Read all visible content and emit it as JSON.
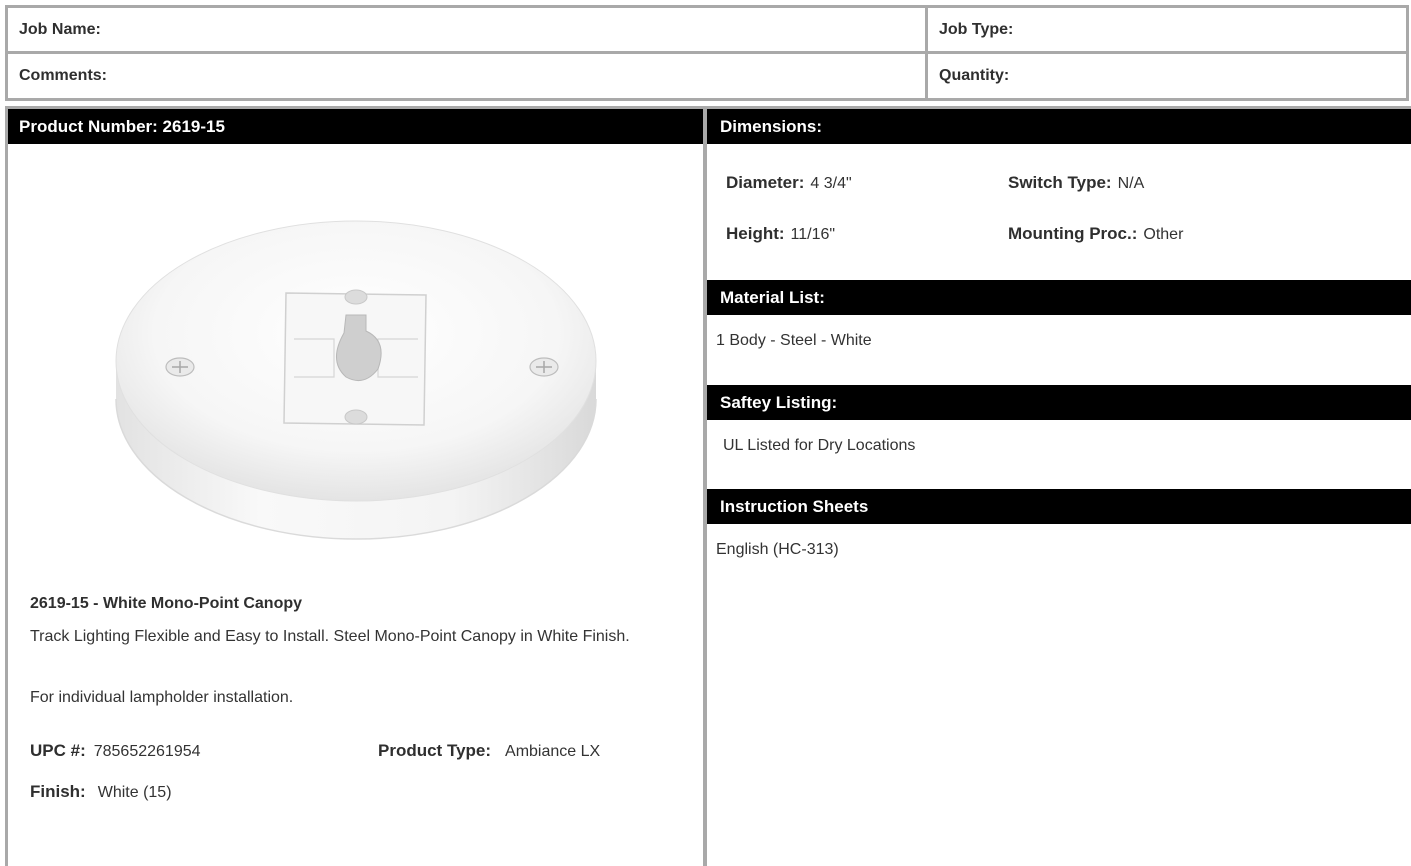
{
  "job": {
    "job_name_label": "Job Name:",
    "job_type_label": "Job Type:",
    "comments_label": "Comments:",
    "quantity_label": "Quantity:"
  },
  "product": {
    "header": "Product Number: 2619-15",
    "title": "2619-15 - White Mono-Point Canopy",
    "description": "Track Lighting Flexible and Easy to Install. Steel Mono-Point Canopy in White Finish.",
    "note": "For individual lampholder installation.",
    "upc_label": "UPC #:",
    "upc_value": "785652261954",
    "type_label": "Product Type:",
    "type_value": "Ambiance LX",
    "finish_label": "Finish:",
    "finish_value": "White (15)"
  },
  "dimensions": {
    "header": "Dimensions:",
    "diameter_label": "Diameter:",
    "diameter_value": "4 3/4\"",
    "height_label": "Height:",
    "height_value": "11/16\"",
    "switch_label": "Switch Type:",
    "switch_value": "N/A",
    "mounting_label": "Mounting Proc.:",
    "mounting_value": "Other"
  },
  "material": {
    "header": "Material List:",
    "item": "1 Body - Steel - White"
  },
  "safety": {
    "header": "Saftey Listing:",
    "item": "UL Listed for Dry Locations"
  },
  "instructions": {
    "header": "Instruction Sheets",
    "item": "English (HC-313)"
  },
  "colors": {
    "bar_bg": "#000000",
    "border": "#a9a9a9"
  }
}
